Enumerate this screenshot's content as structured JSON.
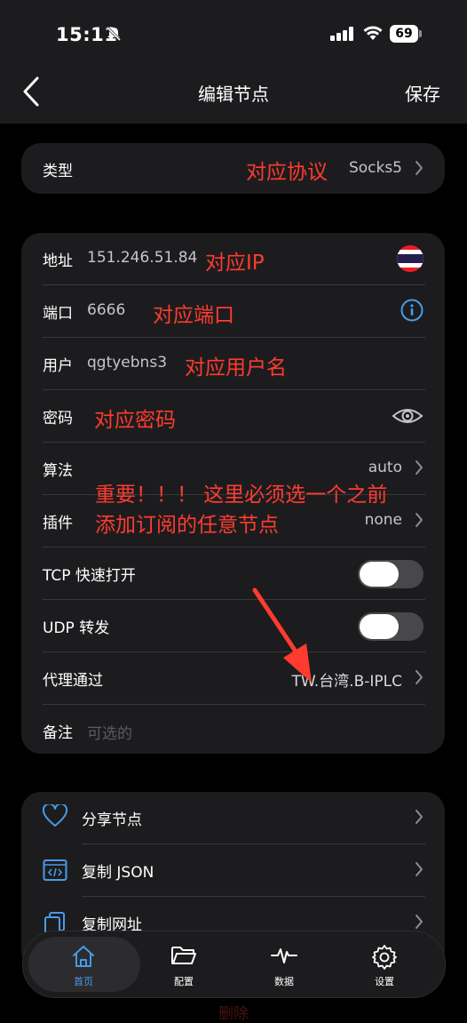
{
  "status_bar": {
    "time": "15:11",
    "battery": "69"
  },
  "nav": {
    "title": "编辑节点",
    "save_label": "保存"
  },
  "type_row": {
    "label": "类型",
    "value": "Socks5",
    "annotation": "对应协议"
  },
  "form": {
    "address": {
      "label": "地址",
      "value": "151.246.51.84",
      "annotation": "对应IP",
      "flag": "thailand-flag"
    },
    "port": {
      "label": "端口",
      "value": "6666",
      "annotation": "对应端口"
    },
    "user": {
      "label": "用户",
      "value": "qgtyebns3",
      "annotation": "对应用户名"
    },
    "password": {
      "label": "密码",
      "value": "",
      "annotation": "对应密码"
    },
    "algorithm": {
      "label": "算法",
      "value": "auto"
    },
    "plugin": {
      "label": "插件",
      "value": "none"
    },
    "important_note": {
      "line1": "重要！！！ 这里必须选一个之前",
      "line2": "添加订阅的任意节点"
    },
    "tcp_fast_open": {
      "label": "TCP 快速打开",
      "enabled": false
    },
    "udp_relay": {
      "label": "UDP 转发",
      "enabled": false
    },
    "proxy_via": {
      "label": "代理通过",
      "value": "TW.台湾.B-IPLC"
    },
    "remark": {
      "label": "备注",
      "placeholder": "可选的"
    }
  },
  "actions": [
    {
      "label": "分享节点",
      "icon": "heart-icon"
    },
    {
      "label": "复制 JSON",
      "icon": "code-icon"
    },
    {
      "label": "复制网址",
      "icon": "copy-icon"
    }
  ],
  "tabs": [
    {
      "label": "首页",
      "icon": "home-icon",
      "active": true
    },
    {
      "label": "配置",
      "icon": "folder-icon",
      "active": false
    },
    {
      "label": "数据",
      "icon": "waveform-icon",
      "active": false
    },
    {
      "label": "设置",
      "icon": "gear-icon",
      "active": false
    }
  ],
  "footer_faded_text": "删除",
  "colors": {
    "accent": "#4a9ae8",
    "annotation": "#ff3b30",
    "card": "#1c1c1e",
    "background": "#000000"
  }
}
